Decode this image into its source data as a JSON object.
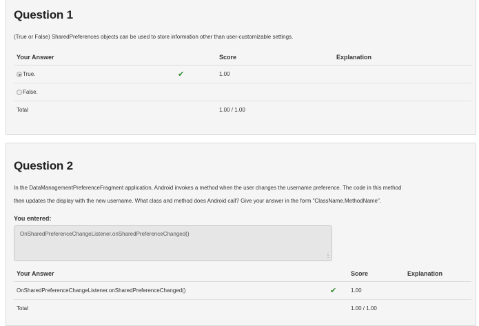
{
  "q1": {
    "title": "Question 1",
    "prompt": "(True or False) SharedPreferences objects can be used to store information other than user-customizable settings.",
    "headers": {
      "answer": "Your Answer",
      "score": "Score",
      "explanation": "Explanation"
    },
    "rows": [
      {
        "answer": "True.",
        "selected": true,
        "correct": true,
        "score": "1.00"
      },
      {
        "answer": "False.",
        "selected": false,
        "correct": false,
        "score": ""
      }
    ],
    "total_label": "Total",
    "total_score": "1.00 / 1.00"
  },
  "q2": {
    "title": "Question 2",
    "prompt_line1": "In the DataManagementPreferenceFragment application, Android invokes a method when the user changes the username preference. The code in this method",
    "prompt_line2": "then updates the display with the new username. What class and method does Android call? Give your answer in the form \"ClassName.MethodName\".",
    "entered_label": "You entered:",
    "entered_value": "OnSharedPreferenceChangeListener.onSharedPreferenceChanged()",
    "headers": {
      "answer": "Your Answer",
      "score": "Score",
      "explanation": "Explanation"
    },
    "rows": [
      {
        "answer": "OnSharedPreferenceChangeListener.onSharedPreferenceChanged()",
        "correct": true,
        "score": "1.00"
      }
    ],
    "total_label": "Total",
    "total_score": "1.00 / 1.00"
  },
  "colors": {
    "check": "#2e8b2e",
    "panel_bg": "#f5f5f5",
    "border": "#d8d8d8"
  },
  "icons": {
    "correct": "check-icon",
    "radio": "radio-icon"
  }
}
